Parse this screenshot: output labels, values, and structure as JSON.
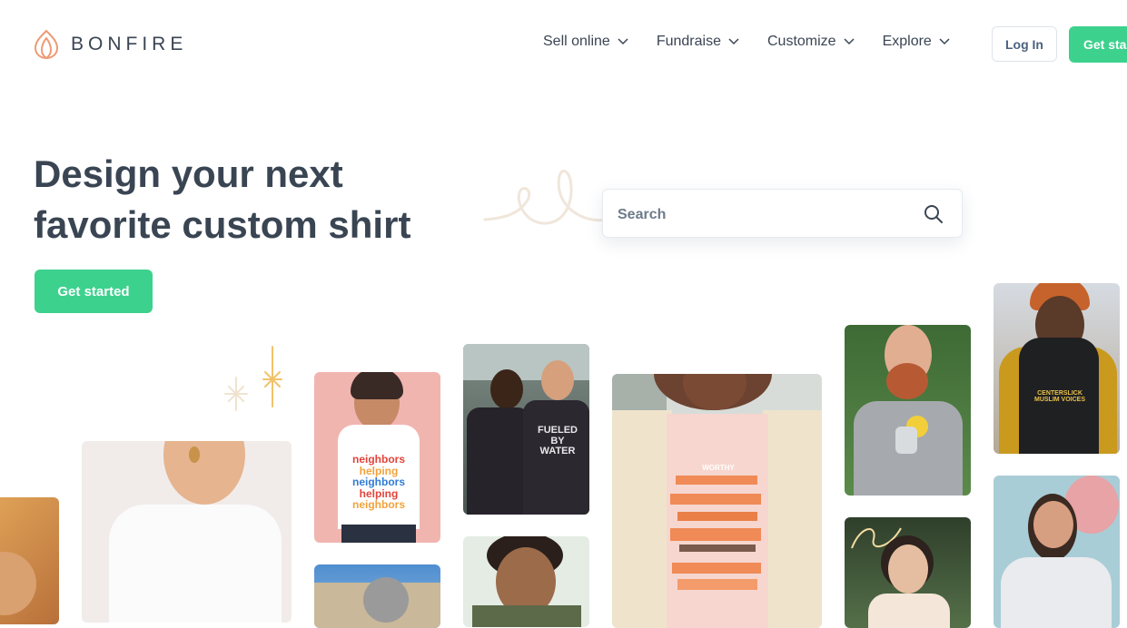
{
  "brand": {
    "name": "BONFIRE",
    "logo_icon": "flame-leaf-icon",
    "accent": "#3dd18e",
    "logo_color": "#ee9a74"
  },
  "nav": {
    "items": [
      {
        "label": "Sell online"
      },
      {
        "label": "Fundraise"
      },
      {
        "label": "Customize"
      },
      {
        "label": "Explore"
      }
    ],
    "login_label": "Log In",
    "get_started_label": "Get started"
  },
  "hero": {
    "title_line1": "Design your next",
    "title_line2": "favorite custom shirt",
    "cta_label": "Get started"
  },
  "search": {
    "placeholder": "Search",
    "icon": "magnifier-icon"
  },
  "gallery": {
    "shirt_texts": {
      "neighbors": [
        "neighbors",
        "helping",
        "neighbors",
        "helping",
        "neighbors"
      ],
      "fueled": "FUELED BY WATER",
      "centerslick": "CENTERSLICK MUSLIM VOICES",
      "worthy": "WORTHY"
    }
  }
}
